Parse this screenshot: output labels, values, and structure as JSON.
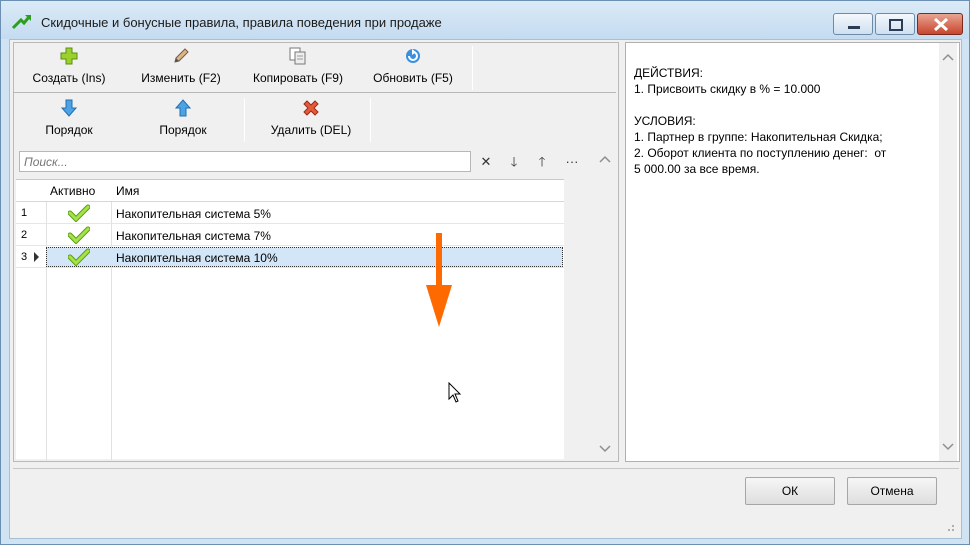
{
  "window": {
    "title": "Скидочные и бонусные правила, правила поведения при продаже",
    "icon": "green-arrow-icon"
  },
  "toolbar": {
    "row1": [
      {
        "label": "Создать (Ins)",
        "icon": "plus-icon"
      },
      {
        "label": "Изменить (F2)",
        "icon": "pencil-icon"
      },
      {
        "label": "Копировать (F9)",
        "icon": "copy-icon"
      },
      {
        "label": "Обновить (F5)",
        "icon": "refresh-icon"
      }
    ],
    "row2": [
      {
        "label": "Порядок",
        "icon": "arrow-down-icon"
      },
      {
        "label": "Порядок",
        "icon": "arrow-up-icon"
      },
      {
        "label": "Удалить (DEL)",
        "icon": "delete-x-icon"
      }
    ]
  },
  "search": {
    "placeholder": "Поиск...",
    "tools": [
      "✕",
      "🡓",
      "🡑",
      "···"
    ]
  },
  "grid": {
    "columns": [
      "Активно",
      "Имя"
    ],
    "rows": [
      {
        "num": "1",
        "name": "Накопительная система 5%"
      },
      {
        "num": "2",
        "name": "Накопительная система 7%"
      },
      {
        "num": "3",
        "name": "Накопительная система 10%"
      }
    ]
  },
  "details": {
    "text": "ДЕЙСТВИЯ:\n1. Присвоить скидку в % = 10.000\n\nУСЛОВИЯ:\n1. Партнер в группе: Накопительная Скидка;\n2. Оборот клиента по поступлению денег:  от\n5 000.00 за все время."
  },
  "buttons": {
    "ok": "ОК",
    "cancel": "Отмена"
  },
  "colors": {
    "accent_arrow": "#ff6a00",
    "selection": "#d2e6f8",
    "check": "#7fc21e"
  }
}
